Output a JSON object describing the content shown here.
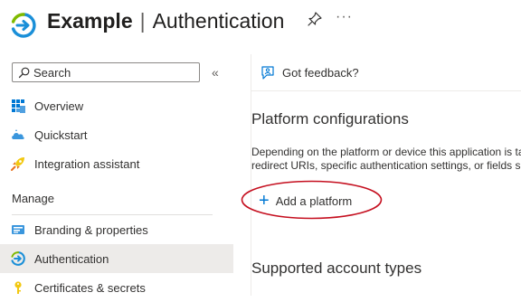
{
  "header": {
    "app_name": "Example",
    "separator": "|",
    "page_title": "Authentication",
    "more_label": "···"
  },
  "sidebar": {
    "search_placeholder": "Search",
    "collapse_glyph": "«",
    "items": [
      {
        "label": "Overview",
        "icon": "overview-grid-icon"
      },
      {
        "label": "Quickstart",
        "icon": "quickstart-cloud-icon"
      },
      {
        "label": "Integration assistant",
        "icon": "rocket-icon"
      }
    ],
    "manage_label": "Manage",
    "manage_items": [
      {
        "label": "Branding & properties",
        "icon": "branding-icon"
      },
      {
        "label": "Authentication",
        "icon": "authentication-icon",
        "active": true
      },
      {
        "label": "Certificates & secrets",
        "icon": "key-icon"
      }
    ]
  },
  "main": {
    "feedback_label": "Got feedback?",
    "platform_heading": "Platform configurations",
    "description_line1": "Depending on the platform or device this application is targeting, additional configuration may be required such as",
    "description_line2": "redirect URIs, specific authentication settings, or fields specific to the platform.",
    "add_platform_label": "Add a platform",
    "add_platform_glyph": "+",
    "supported_heading": "Supported account types"
  },
  "colors": {
    "accent": "#0078d4",
    "logo_green": "#7fba00",
    "annotation_red": "#c50f1f",
    "active_bg": "#edebe9"
  }
}
